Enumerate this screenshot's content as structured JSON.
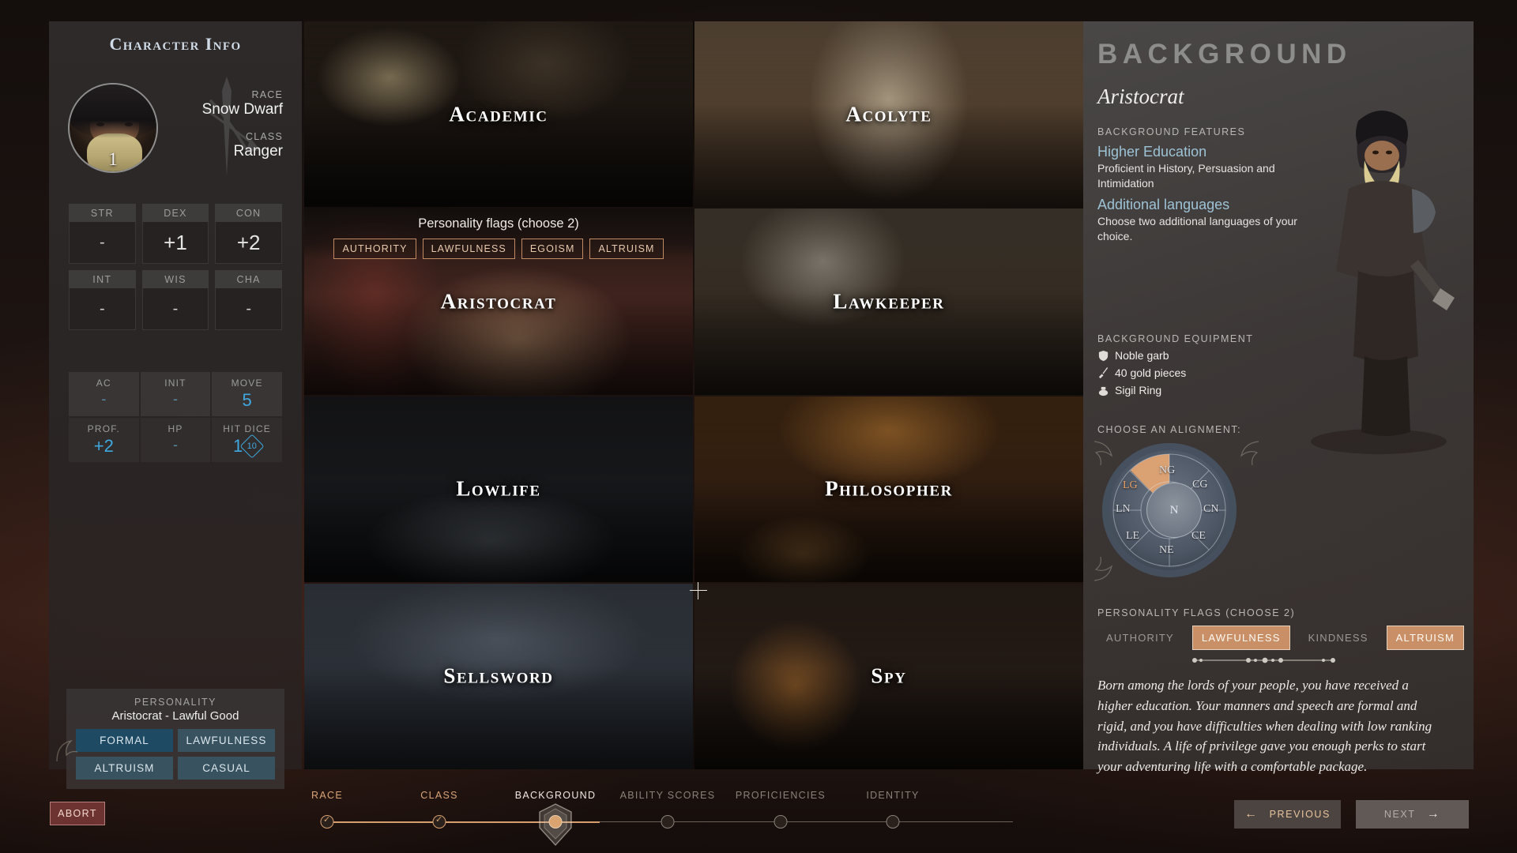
{
  "left": {
    "title": "Character Info",
    "level": "1",
    "race_label": "RACE",
    "race_value": "Snow Dwarf",
    "class_label": "CLASS",
    "class_value": "Ranger",
    "abilities": [
      {
        "key": "STR",
        "value": "-"
      },
      {
        "key": "DEX",
        "value": "+1"
      },
      {
        "key": "CON",
        "value": "+2"
      },
      {
        "key": "INT",
        "value": "-"
      },
      {
        "key": "WIS",
        "value": "-"
      },
      {
        "key": "CHA",
        "value": "-"
      }
    ],
    "derived": [
      {
        "key": "AC",
        "value": "-"
      },
      {
        "key": "INIT",
        "value": "-"
      },
      {
        "key": "MOVE",
        "value": "5"
      },
      {
        "key": "PROF.",
        "value": "+2"
      },
      {
        "key": "HP",
        "value": "-"
      },
      {
        "key": "HIT DICE",
        "value": "1",
        "die": "10"
      }
    ],
    "personality": {
      "title": "PERSONALITY",
      "subtitle": "Aristocrat - Lawful Good",
      "flags": [
        {
          "label": "FORMAL",
          "selected": true
        },
        {
          "label": "LAWFULNESS",
          "selected": false
        },
        {
          "label": "ALTRUISM",
          "selected": false
        },
        {
          "label": "CASUAL",
          "selected": false
        }
      ]
    }
  },
  "grid": {
    "tiles": [
      {
        "name": "Academic",
        "art": "art-academic",
        "selected": false
      },
      {
        "name": "Acolyte",
        "art": "art-acolyte",
        "selected": false
      },
      {
        "name": "Aristocrat",
        "art": "art-aristocrat",
        "selected": true
      },
      {
        "name": "Lawkeeper",
        "art": "art-lawkeeper",
        "selected": false
      },
      {
        "name": "Lowlife",
        "art": "art-lowlife",
        "selected": false
      },
      {
        "name": "Philosopher",
        "art": "art-philosopher",
        "selected": false
      },
      {
        "name": "Sellsword",
        "art": "art-sellsword",
        "selected": false
      },
      {
        "name": "Spy",
        "art": "art-spy",
        "selected": false
      }
    ],
    "flag_overlay": {
      "title": "Personality flags (choose 2)",
      "chips": [
        "AUTHORITY",
        "LAWFULNESS",
        "EGOISM",
        "ALTRUISM"
      ]
    }
  },
  "right": {
    "header": "BACKGROUND",
    "subheader": "Aristocrat",
    "features_label": "BACKGROUND FEATURES",
    "features": [
      {
        "name": "Higher Education",
        "desc": "Proficient in History, Persuasion and Intimidation"
      },
      {
        "name": "Additional languages",
        "desc": "Choose two additional languages of your choice."
      }
    ],
    "equipment_label": "BACKGROUND EQUIPMENT",
    "equipment": [
      {
        "icon": "shield-icon",
        "label": "Noble garb"
      },
      {
        "icon": "sword-icon",
        "label": "40 gold pieces"
      },
      {
        "icon": "ring-icon",
        "label": "Sigil Ring"
      }
    ],
    "alignment_label": "CHOOSE AN ALIGNMENT:",
    "alignment_segments": [
      "LG",
      "NG",
      "CG",
      "CN",
      "CE",
      "NE",
      "LE",
      "LN"
    ],
    "alignment_center": "N",
    "alignment_selected": "LG",
    "flags_label": "PERSONALITY FLAGS (CHOOSE 2)",
    "flags": [
      {
        "label": "AUTHORITY",
        "selected": false
      },
      {
        "label": "LAWFULNESS",
        "selected": true
      },
      {
        "label": "KINDNESS",
        "selected": false
      },
      {
        "label": "ALTRUISM",
        "selected": true
      }
    ],
    "description": "Born among the lords of your people, you have received a higher education. Your manners and speech are formal and rigid, and you have difficulties when dealing with low ranking individuals. A life of privilege gave you enough perks to start your adventuring life with a comfortable package."
  },
  "bottom": {
    "abort": "ABORT",
    "steps": [
      {
        "label": "RACE",
        "state": "done"
      },
      {
        "label": "CLASS",
        "state": "done"
      },
      {
        "label": "BACKGROUND",
        "state": "current"
      },
      {
        "label": "ABILITY SCORES",
        "state": "todo"
      },
      {
        "label": "PROFICIENCIES",
        "state": "todo"
      },
      {
        "label": "IDENTITY",
        "state": "todo"
      }
    ],
    "previous": "PREVIOUS",
    "next": "NEXT"
  },
  "colors": {
    "accent": "#d79f6f",
    "blue": "#3fa9e0",
    "flag_on": "#c99068",
    "abort": "#8a403e"
  }
}
